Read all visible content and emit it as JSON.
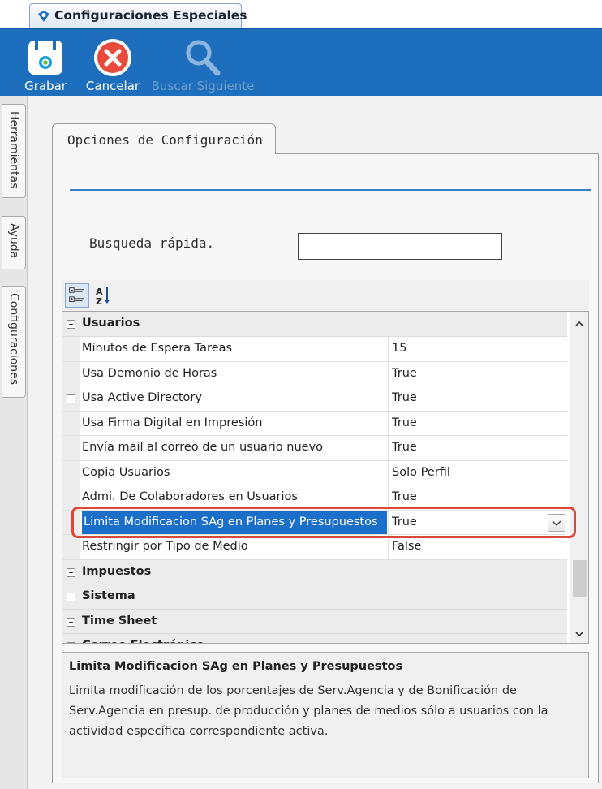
{
  "window": {
    "title": "Configuraciones Especiales"
  },
  "toolbar": {
    "buttons": [
      {
        "label": "Grabar",
        "icon": "save-icon",
        "enabled": true
      },
      {
        "label": "Cancelar",
        "icon": "cancel-icon",
        "enabled": true
      },
      {
        "label": "Buscar Siguiente",
        "icon": "search-icon",
        "enabled": false
      }
    ],
    "accent": "#1d6fbd"
  },
  "side_tabs": [
    "Herramientas",
    "Ayuda",
    "Configuraciones"
  ],
  "panel": {
    "tab_label": "Opciones de Configuración",
    "search_label": "Busqueda rápida.",
    "search_value": ""
  },
  "grid": {
    "categories": [
      {
        "name": "Usuarios",
        "expanded": true,
        "properties": [
          {
            "name": "Minutos de Espera Tareas",
            "value": "15",
            "expandable": false
          },
          {
            "name": "Usa Demonio de Horas",
            "value": "True",
            "expandable": false
          },
          {
            "name": "Usa Active Directory",
            "value": "True",
            "expandable": true
          },
          {
            "name": "Usa Firma Digital en Impresión",
            "value": "True",
            "expandable": false
          },
          {
            "name": "Envía mail al correo de un usuario nuevo",
            "value": "True",
            "expandable": false
          },
          {
            "name": "Copia Usuarios",
            "value": "Solo Perfil",
            "expandable": false
          },
          {
            "name": "Admi. De Colaboradores en Usuarios",
            "value": "True",
            "expandable": false
          },
          {
            "name": "Limita Modificacion SAg en Planes y Presupuestos",
            "value": "True",
            "expandable": false,
            "selected": true
          },
          {
            "name": "Restringir por Tipo de Medio",
            "value": "False",
            "expandable": false
          }
        ]
      },
      {
        "name": "Impuestos",
        "expanded": false
      },
      {
        "name": "Sistema",
        "expanded": false
      },
      {
        "name": "Time Sheet",
        "expanded": false
      },
      {
        "name": "Correo Electrónico",
        "expanded": true
      }
    ],
    "selection_color": "#1b6fc9",
    "highlight_color": "#d9493a"
  },
  "description": {
    "title": "Limita Modificacion SAg en Planes y Presupuestos",
    "text": "Limita modificación de los porcentajes de Serv.Agencia y de Bonificación de Serv.Agencia en presup. de producción y planes de medios sólo a usuarios con la actividad específica correspondiente activa."
  }
}
